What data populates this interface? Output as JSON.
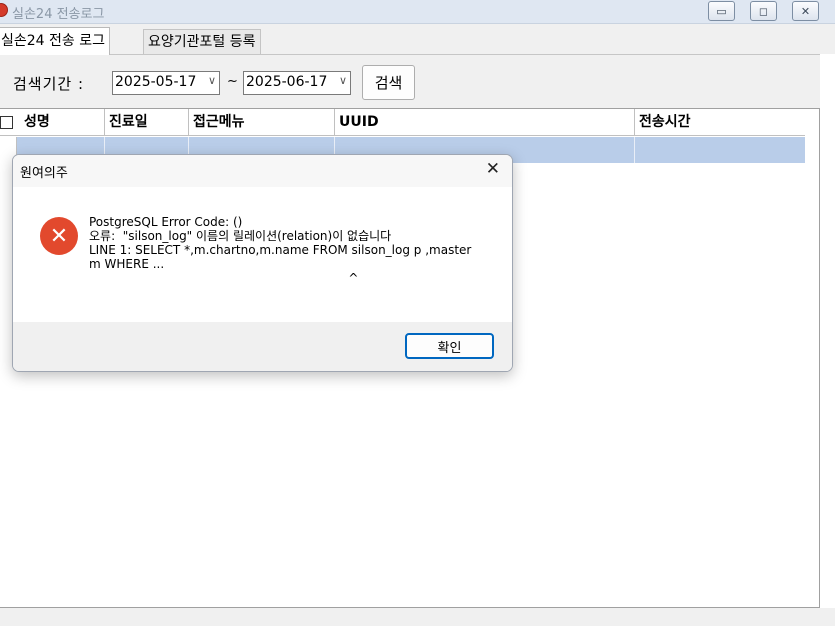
{
  "window": {
    "title": "실손24 전송로그",
    "minimize_symbol": "▭",
    "maximize_symbol": "◻",
    "close_symbol": "✕"
  },
  "tabs": [
    {
      "label": "실손24 전송 로그"
    },
    {
      "label": "요양기관포털 등록"
    }
  ],
  "search": {
    "period_label": "검색기간 :",
    "start_date": "2025-05-17",
    "end_date": "2025-06-17",
    "dropdown_symbol": "∨",
    "range_separator": "~",
    "button_label": "검색"
  },
  "table": {
    "columns": [
      "성명",
      "진료일",
      "접근메뉴",
      "UUID",
      "전송시간"
    ],
    "selected_row_color": "#b9cde9"
  },
  "dialog": {
    "title": "원여의주",
    "close_symbol": "✕",
    "icon": "error-x-icon",
    "icon_color": "#e2492d",
    "icon_symbol": "✕",
    "message": "PostgreSQL Error Code: ()\n오류:  \"silson_log\" 이름의 릴레이션(relation)이 없습니다\nLINE 1: SELECT *,m.chartno,m.name FROM silson_log p ,master\nm WHERE ...\n                                                                    ^",
    "ok_label": "확인"
  }
}
